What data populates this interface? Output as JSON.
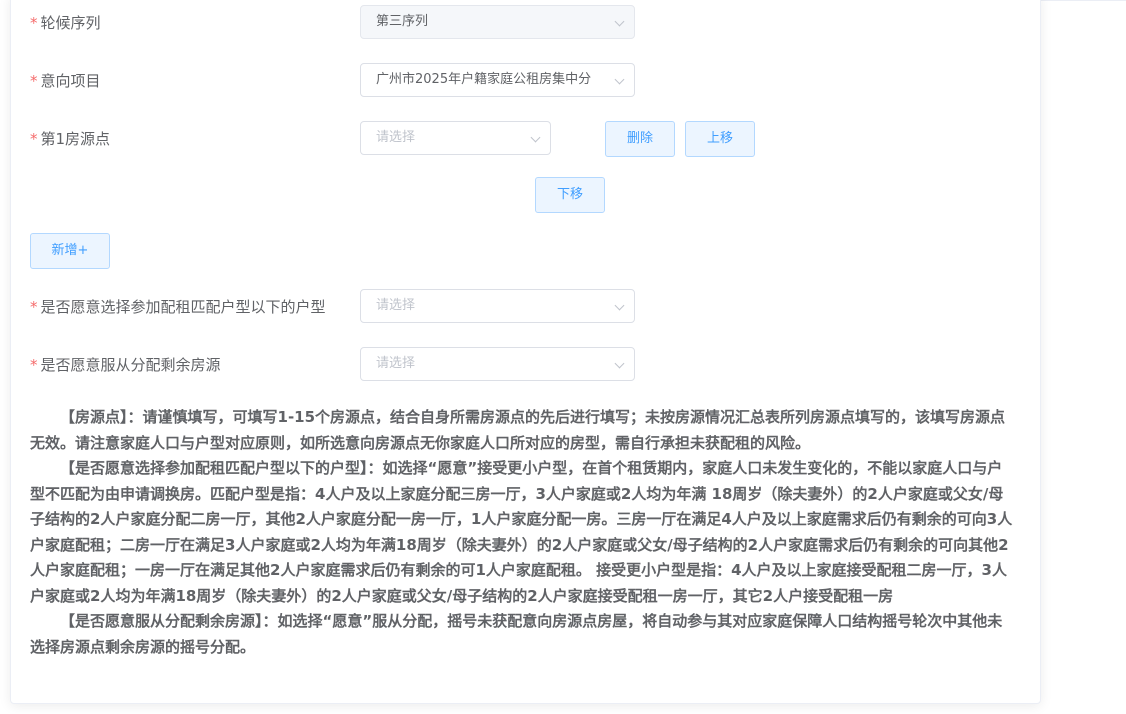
{
  "form": {
    "rotation_sequence": {
      "label": "轮候序列",
      "value": "第三序列"
    },
    "intended_project": {
      "label": "意向项目",
      "value": "广州市2025年户籍家庭公租房集中分"
    },
    "housing_point_1": {
      "label": "第1房源点",
      "placeholder": "请选择"
    },
    "buttons": {
      "delete": "删除",
      "move_up": "上移",
      "move_down": "下移",
      "add": "新增+"
    },
    "accept_smaller_type": {
      "label": "是否愿意选择参加配租匹配户型以下的户型",
      "placeholder": "请选择"
    },
    "accept_remaining": {
      "label": "是否愿意服从分配剩余房源",
      "placeholder": "请选择"
    },
    "required_mark": "*"
  },
  "notes": {
    "housing_point": "【房源点】：请谨慎填写，可填写1-15个房源点，结合自身所需房源点的先后进行填写；未按房源情况汇总表所列房源点填写的，该填写房源点无效。请注意家庭人口与户型对应原则，如所选意向房源点无你家庭人口所对应的房型，需自行承担未获配租的风险。",
    "smaller_type": "【是否愿意选择参加配租匹配户型以下的户型】：如选择“愿意”接受更小户型，在首个租赁期内，家庭人口未发生变化的，不能以家庭人口与户型不匹配为由申请调换房。匹配户型是指：4人户及以上家庭分配三房一厅，3人户家庭或2人均为年满 18周岁（除夫妻外）的2人户家庭或父女/母子结构的2人户家庭分配二房一厅，其他2人户家庭分配一房一厅，1人户家庭分配一房。三房一厅在满足4人户及以上家庭需求后仍有剩余的可向3人户家庭配租；二房一厅在满足3人户家庭或2人均为年满18周岁（除夫妻外）的2人户家庭或父女/母子结构的2人户家庭需求后仍有剩余的可向其他2人户家庭配租；一房一厅在满足其他2人户家庭需求后仍有剩余的可1人户家庭配租。 接受更小户型是指：4人户及以上家庭接受配租二房一厅，3人户家庭或2人均为年满18周岁（除夫妻外）的2人户家庭或父女/母子结构的2人户家庭接受配租一房一厅，其它2人户接受配租一房",
    "remaining": "【是否愿意服从分配剩余房源】：如选择“愿意”服从分配，摇号未获配意向房源点房屋，将自动参与其对应家庭保障人口结构摇号轮次中其他未选择房源点剩余房源的摇号分配。"
  },
  "colors": {
    "required": "#f56c6c",
    "button_bg": "#ecf5ff",
    "button_border": "#b3d8ff",
    "button_text": "#409eff",
    "label_text": "#606266",
    "placeholder": "#c0c4cc"
  }
}
